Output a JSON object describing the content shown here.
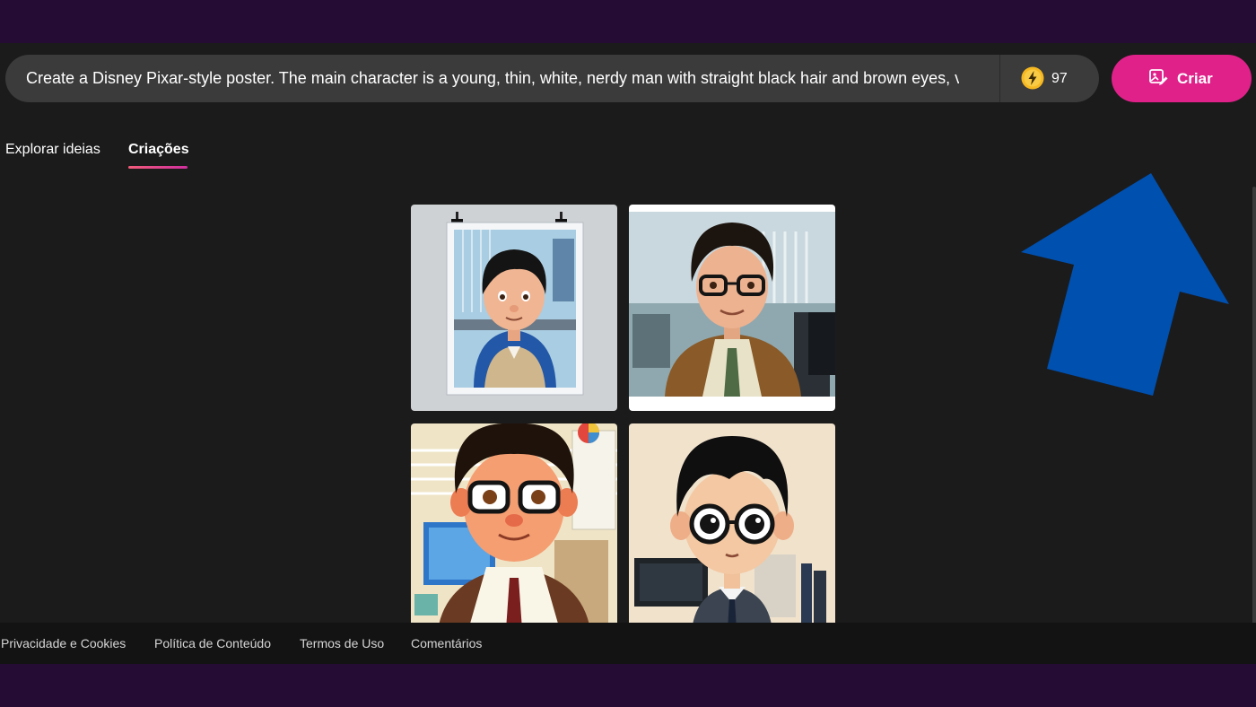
{
  "prompt": {
    "text": "Create a Disney Pixar-style poster. The main character is a young, thin, white, nerdy man with straight black hair and brown eyes, v"
  },
  "credits": {
    "count": "97",
    "icon": "lightning-coin-icon"
  },
  "create_button": {
    "label": "Criar",
    "icon": "image-edit-icon"
  },
  "tabs": [
    {
      "label": "Explorar ideias",
      "active": false
    },
    {
      "label": "Criações",
      "active": true
    }
  ],
  "gallery": {
    "images": [
      {
        "icon": "generated-image-1"
      },
      {
        "icon": "generated-image-2"
      },
      {
        "icon": "generated-image-3"
      },
      {
        "icon": "generated-image-4"
      }
    ]
  },
  "footer": {
    "links": [
      "Privacidade e Cookies",
      "Política de Conteúdo",
      "Termos de Uso",
      "Comentários"
    ]
  },
  "colors": {
    "accent": "#e0218a",
    "background": "#1b1b1b",
    "frame": "#240c35",
    "annotation_arrow": "#0050b0"
  }
}
